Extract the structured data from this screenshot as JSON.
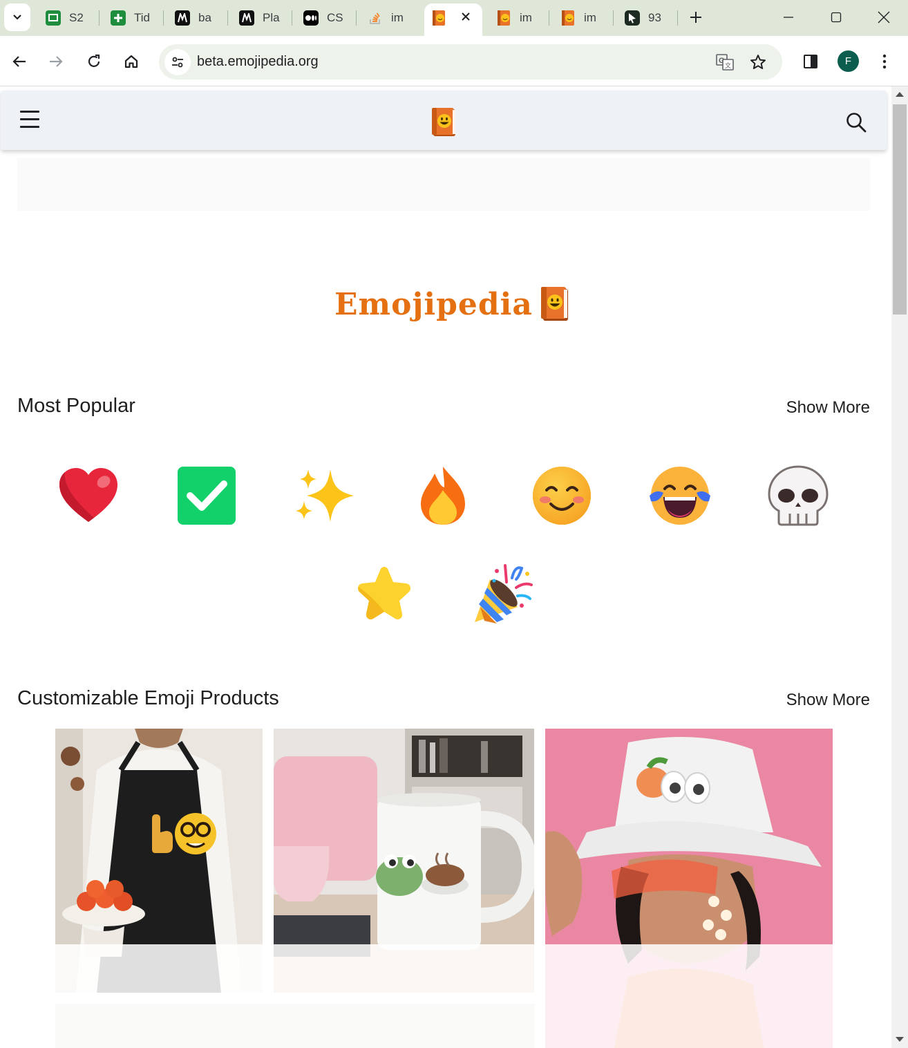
{
  "browser": {
    "tabs": [
      {
        "label": "S2",
        "icon": "google-slides-icon"
      },
      {
        "label": "Tid",
        "icon": "google-sheets-icon"
      },
      {
        "label": "ba",
        "icon": "m-app-icon"
      },
      {
        "label": "Pla",
        "icon": "m-app-icon"
      },
      {
        "label": "CS",
        "icon": "medium-icon"
      },
      {
        "label": "im",
        "icon": "stackoverflow-icon"
      },
      {
        "label": "",
        "icon": "emojipedia-icon",
        "active": true
      },
      {
        "label": "im",
        "icon": "emojipedia-icon"
      },
      {
        "label": "im",
        "icon": "emojipedia-icon"
      },
      {
        "label": "93",
        "icon": "cursor-app-icon"
      }
    ],
    "url": "beta.emojipedia.org",
    "profile_initial": "F"
  },
  "page": {
    "brand_name": "Emojipedia",
    "most_popular": {
      "title": "Most Popular",
      "show_more": "Show More",
      "emojis": [
        "red-heart",
        "check-mark-button",
        "sparkles",
        "fire",
        "smiling-face-with-smiling-eyes",
        "face-with-tears-of-joy",
        "skull",
        "star",
        "party-popper"
      ]
    },
    "products": {
      "title": "Customizable Emoji Products",
      "show_more": "Show More",
      "items": [
        "apron-product",
        "mug-product",
        "bucket-hat-product"
      ]
    }
  },
  "colors": {
    "brand_orange": "#e47011",
    "tabstrip_bg": "#dfe7d9",
    "header_bg": "#eef2f7"
  }
}
